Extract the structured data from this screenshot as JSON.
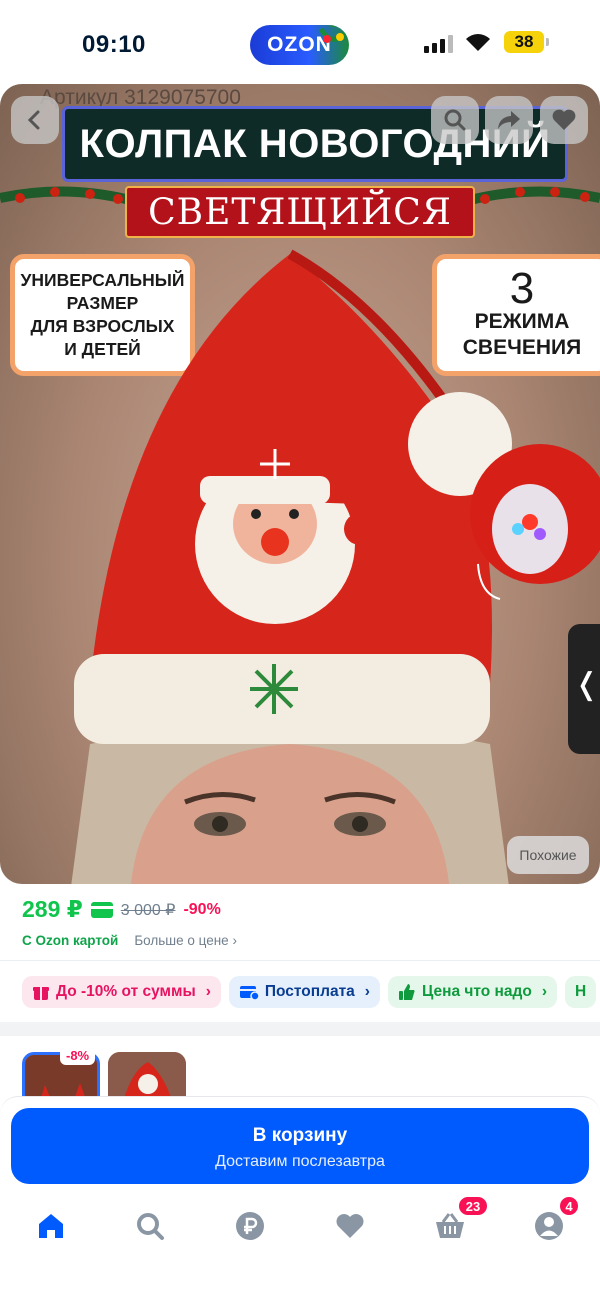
{
  "status_bar": {
    "time": "09:10",
    "battery": "38",
    "brand": "OZON"
  },
  "product_image": {
    "article": "Артикул 3129075700",
    "title": "КОЛПАК НОВОГОДНИЙ",
    "subtitle": "СВЕТЯЩИЙСЯ",
    "left_card": [
      "УНИВЕРСАЛЬНЫЙ",
      "РАЗМЕР",
      "ДЛЯ ВЗРОСЛЫХ",
      "И ДЕТЕЙ"
    ],
    "right_card": {
      "number": "3",
      "line1": "РЕЖИМА",
      "line2": "СВЕЧЕНИЯ"
    },
    "similar_label": "Похожие",
    "side_tab_glyph": "❬"
  },
  "price": {
    "main": "289 ₽",
    "old": "3 000 ₽",
    "discount": "-90%",
    "with_card": "С Ozon картой",
    "more_about_price": "Больше о цене",
    "more_arrow": "›"
  },
  "chips": [
    {
      "label": "До -10% от суммы",
      "icon": "gift-icon"
    },
    {
      "label": "Постоплата",
      "icon": "card-icon"
    },
    {
      "label": "Цена что надо",
      "icon": "thumbs-up-icon"
    },
    {
      "label": "Н"
    }
  ],
  "chip_arrow": "›",
  "variants": {
    "badge": "-8%"
  },
  "cart_button": {
    "label": "В корзину",
    "sublabel": "Доставим послезавтра"
  },
  "tabbar": {
    "items": [
      {
        "icon": "home-icon"
      },
      {
        "icon": "search-icon"
      },
      {
        "icon": "ruble-icon"
      },
      {
        "icon": "heart-icon"
      },
      {
        "icon": "basket-icon"
      },
      {
        "icon": "profile-icon"
      }
    ],
    "cart_count": "23",
    "profile_count": "4"
  },
  "colors": {
    "accent": "#005bff",
    "price_green": "#10c44c",
    "discount_pink": "#f91155"
  }
}
